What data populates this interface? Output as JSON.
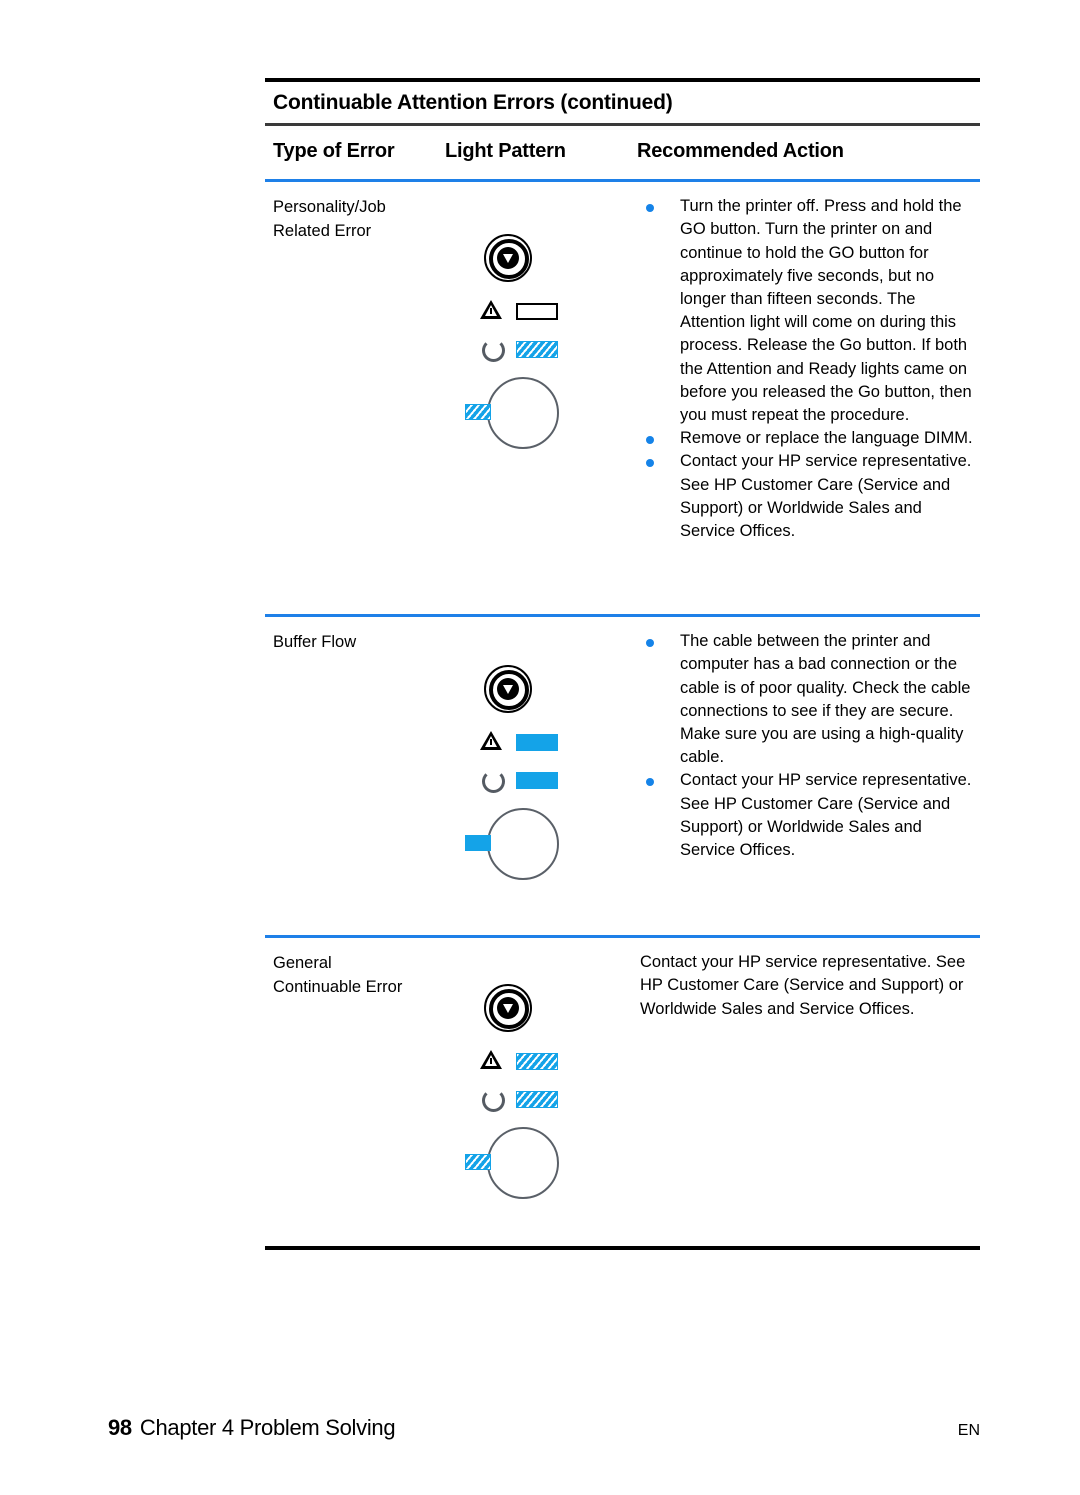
{
  "document": {
    "caption": "Continuable Attention Errors (continued)",
    "columns": {
      "type_of_error": "Type of Error",
      "light_pattern": "Light Pattern",
      "recommended_action": "Recommended Action"
    }
  },
  "colors": {
    "bullet": "#1583e8",
    "led_on": "#14a3e8",
    "separator_blue": "#1e80e8",
    "rule_black": "#000000",
    "glyph_gray": "#555b63"
  },
  "rows": [
    {
      "type_of_error": "Personality/Job\nRelated Error",
      "type_line_1": "Personality/Job",
      "type_line_2": "Related Error",
      "light_pattern": {
        "go_button": "go-button-icon",
        "attention_light": "off",
        "ready_light": "blinking",
        "data_light": "blinking"
      },
      "bulleted": true,
      "actions": [
        "Turn the printer off. Press and hold the GO button. Turn the printer on and continue to hold the GO button for approximately five seconds, but no longer than fifteen seconds. The Attention light will come on during this process.  Release the Go button.  If both the Attention and Ready lights came on before you released the Go button, then you must repeat the procedure.",
        "Remove or replace the language DIMM.",
        "Contact your HP service representative. See HP Customer Care (Service and Support) or Worldwide Sales and Service Offices."
      ]
    },
    {
      "type_of_error": "Buffer Flow",
      "type_line_1": "Buffer Flow",
      "type_line_2": "",
      "light_pattern": {
        "go_button": "go-button-icon",
        "attention_light": "on",
        "ready_light": "on",
        "data_light": "on"
      },
      "bulleted": true,
      "actions": [
        "The cable between the printer and computer has a bad connection or the cable is of poor quality. Check the cable connections to see if they are secure. Make sure you are using a high-quality cable.",
        "Contact your HP service representative. See HP Customer Care (Service and Support) or Worldwide Sales and Service Offices."
      ]
    },
    {
      "type_of_error": "General\nContinuable Error",
      "type_line_1": "General",
      "type_line_2": "Continuable Error",
      "light_pattern": {
        "go_button": "go-button-icon",
        "attention_light": "blinking",
        "ready_light": "blinking",
        "data_light": "blinking"
      },
      "bulleted": false,
      "actions": [
        "Contact your HP service representative. See HP Customer Care (Service and Support) or Worldwide Sales and Service Offices."
      ]
    }
  ],
  "footer": {
    "page_number": "98",
    "chapter_text": "Chapter 4 Problem Solving",
    "language_code": "EN"
  }
}
